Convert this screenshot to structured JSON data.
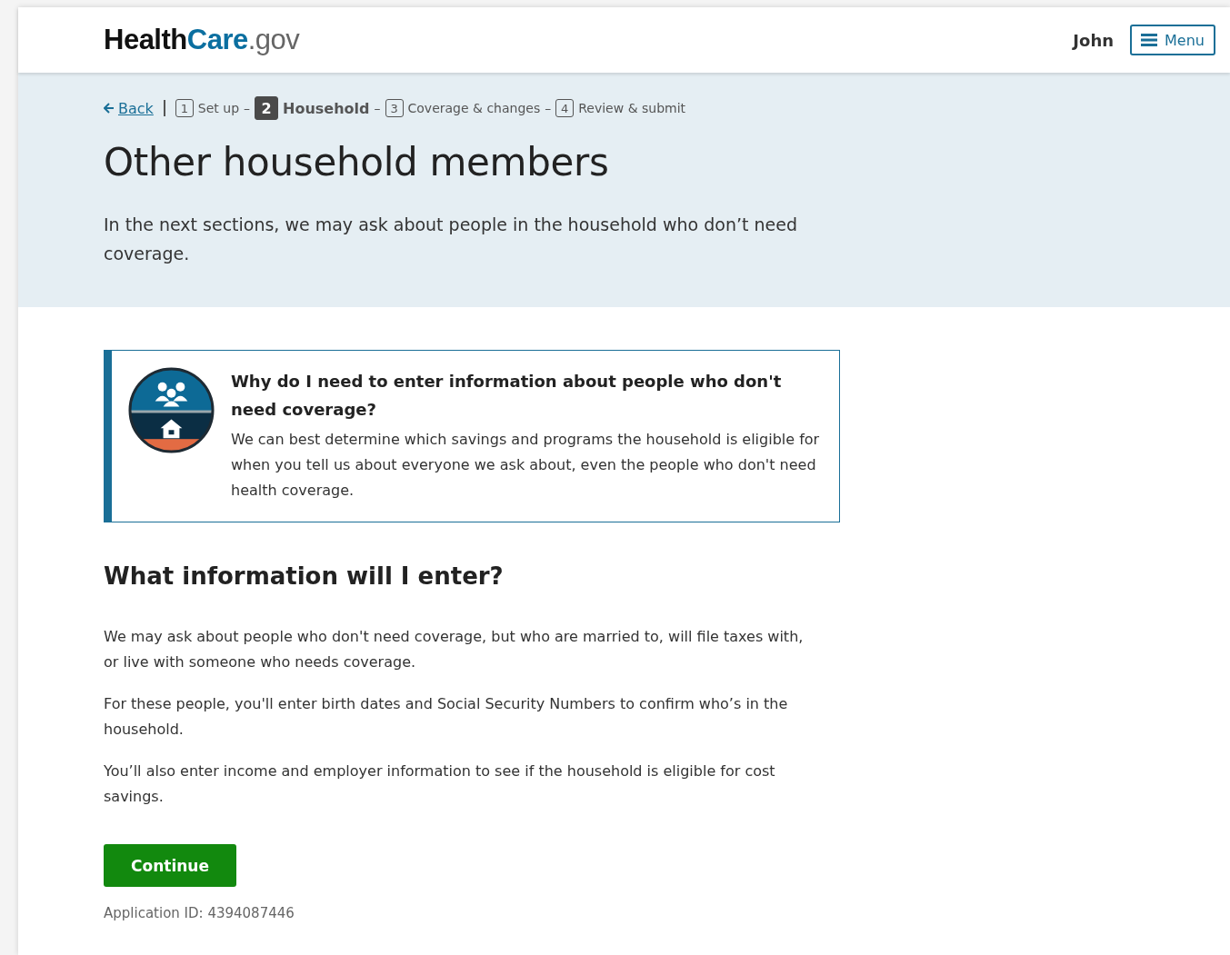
{
  "header": {
    "logo": {
      "part_1": "Health",
      "part_2": "Care",
      "part_3": ".gov"
    },
    "user": "John",
    "menu_button": "Menu"
  },
  "progress": {
    "back": "Back",
    "separator": "–",
    "steps": [
      {
        "number": "1",
        "label": "Set up",
        "selected": false
      },
      {
        "number": "2",
        "label": "Household",
        "selected": true
      },
      {
        "number": "3",
        "label": "Coverage & changes",
        "selected": false
      },
      {
        "number": "4",
        "label": "Review & submit",
        "selected": false
      }
    ]
  },
  "title": "Other household members",
  "intro": "In the next sections, we may ask about people in the household who don’t need coverage.",
  "callout": {
    "heading": "Why do I need to enter information about people who don't need coverage?",
    "body": "We can best determine which savings and programs the household is eligible for when you tell us about everyone we ask about, even the people who don't need health coverage."
  },
  "section_heading": "What information will I enter?",
  "paragraphs": [
    "We may ask about people who don't need coverage, but who are married to, will file taxes with, or live with someone who needs coverage.",
    "For these people, you'll enter birth dates and Social Security Numbers to confirm who’s in the household.",
    "You’ll also enter income and employer information to see if the household is eligible for cost savings."
  ],
  "continue_button": "Continue",
  "application_id": "Application ID: 4394087446"
}
